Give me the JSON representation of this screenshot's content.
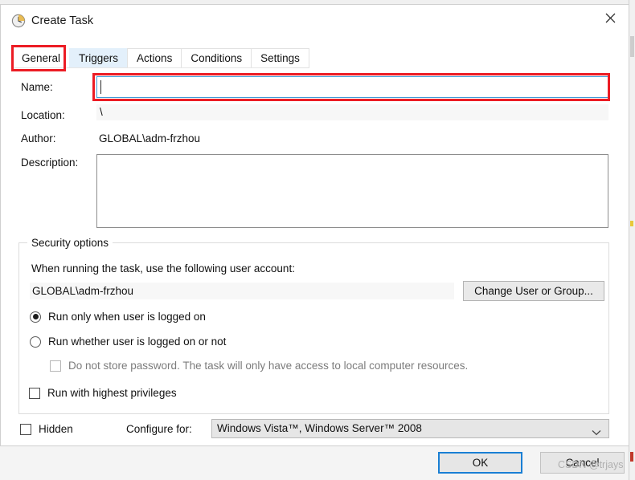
{
  "background": {
    "menu_hint": "··· ···"
  },
  "window": {
    "title": "Create Task",
    "icon": "clock-task-icon",
    "close_label": "✕"
  },
  "tabs": [
    {
      "label": "General",
      "state": "selected"
    },
    {
      "label": "Triggers",
      "state": "hovered"
    },
    {
      "label": "Actions",
      "state": "normal"
    },
    {
      "label": "Conditions",
      "state": "normal"
    },
    {
      "label": "Settings",
      "state": "normal"
    }
  ],
  "general": {
    "name_label": "Name:",
    "name_value": "",
    "name_placeholder": "",
    "location_label": "Location:",
    "location_value": "\\",
    "author_label": "Author:",
    "author_value": "GLOBAL\\adm-frzhou",
    "description_label": "Description:",
    "description_value": "",
    "description_placeholder": ""
  },
  "security": {
    "group_title": "Security options",
    "caption": "When running the task, use the following user account:",
    "account_value": "GLOBAL\\adm-frzhou",
    "change_user_button": "Change User or Group...",
    "options": [
      {
        "type": "radio",
        "label": "Run only when user is logged on",
        "checked": true,
        "disabled": false
      },
      {
        "type": "radio",
        "label": "Run whether user is logged on or not",
        "checked": false,
        "disabled": false
      },
      {
        "type": "checkbox",
        "label": "Do not store password.  The task will only have access to local computer resources.",
        "checked": false,
        "disabled": true
      },
      {
        "type": "checkbox",
        "label": "Run with highest privileges",
        "checked": false,
        "disabled": false
      }
    ]
  },
  "footer": {
    "hidden_label": "Hidden",
    "hidden_checked": false,
    "configure_label": "Configure for:",
    "configure_value": "Windows Vista™, Windows Server™ 2008",
    "configure_icon": "chevron-down-icon",
    "ok_label": "OK",
    "cancel_label": "Cancel"
  },
  "watermark": {
    "text": "CSDN @trjays"
  },
  "colors": {
    "accent_focus": "#1a7fd4",
    "annotation": "#ec1c24",
    "tab_hover": "#e3f0fb",
    "dialog_bg": "#ffffff"
  }
}
